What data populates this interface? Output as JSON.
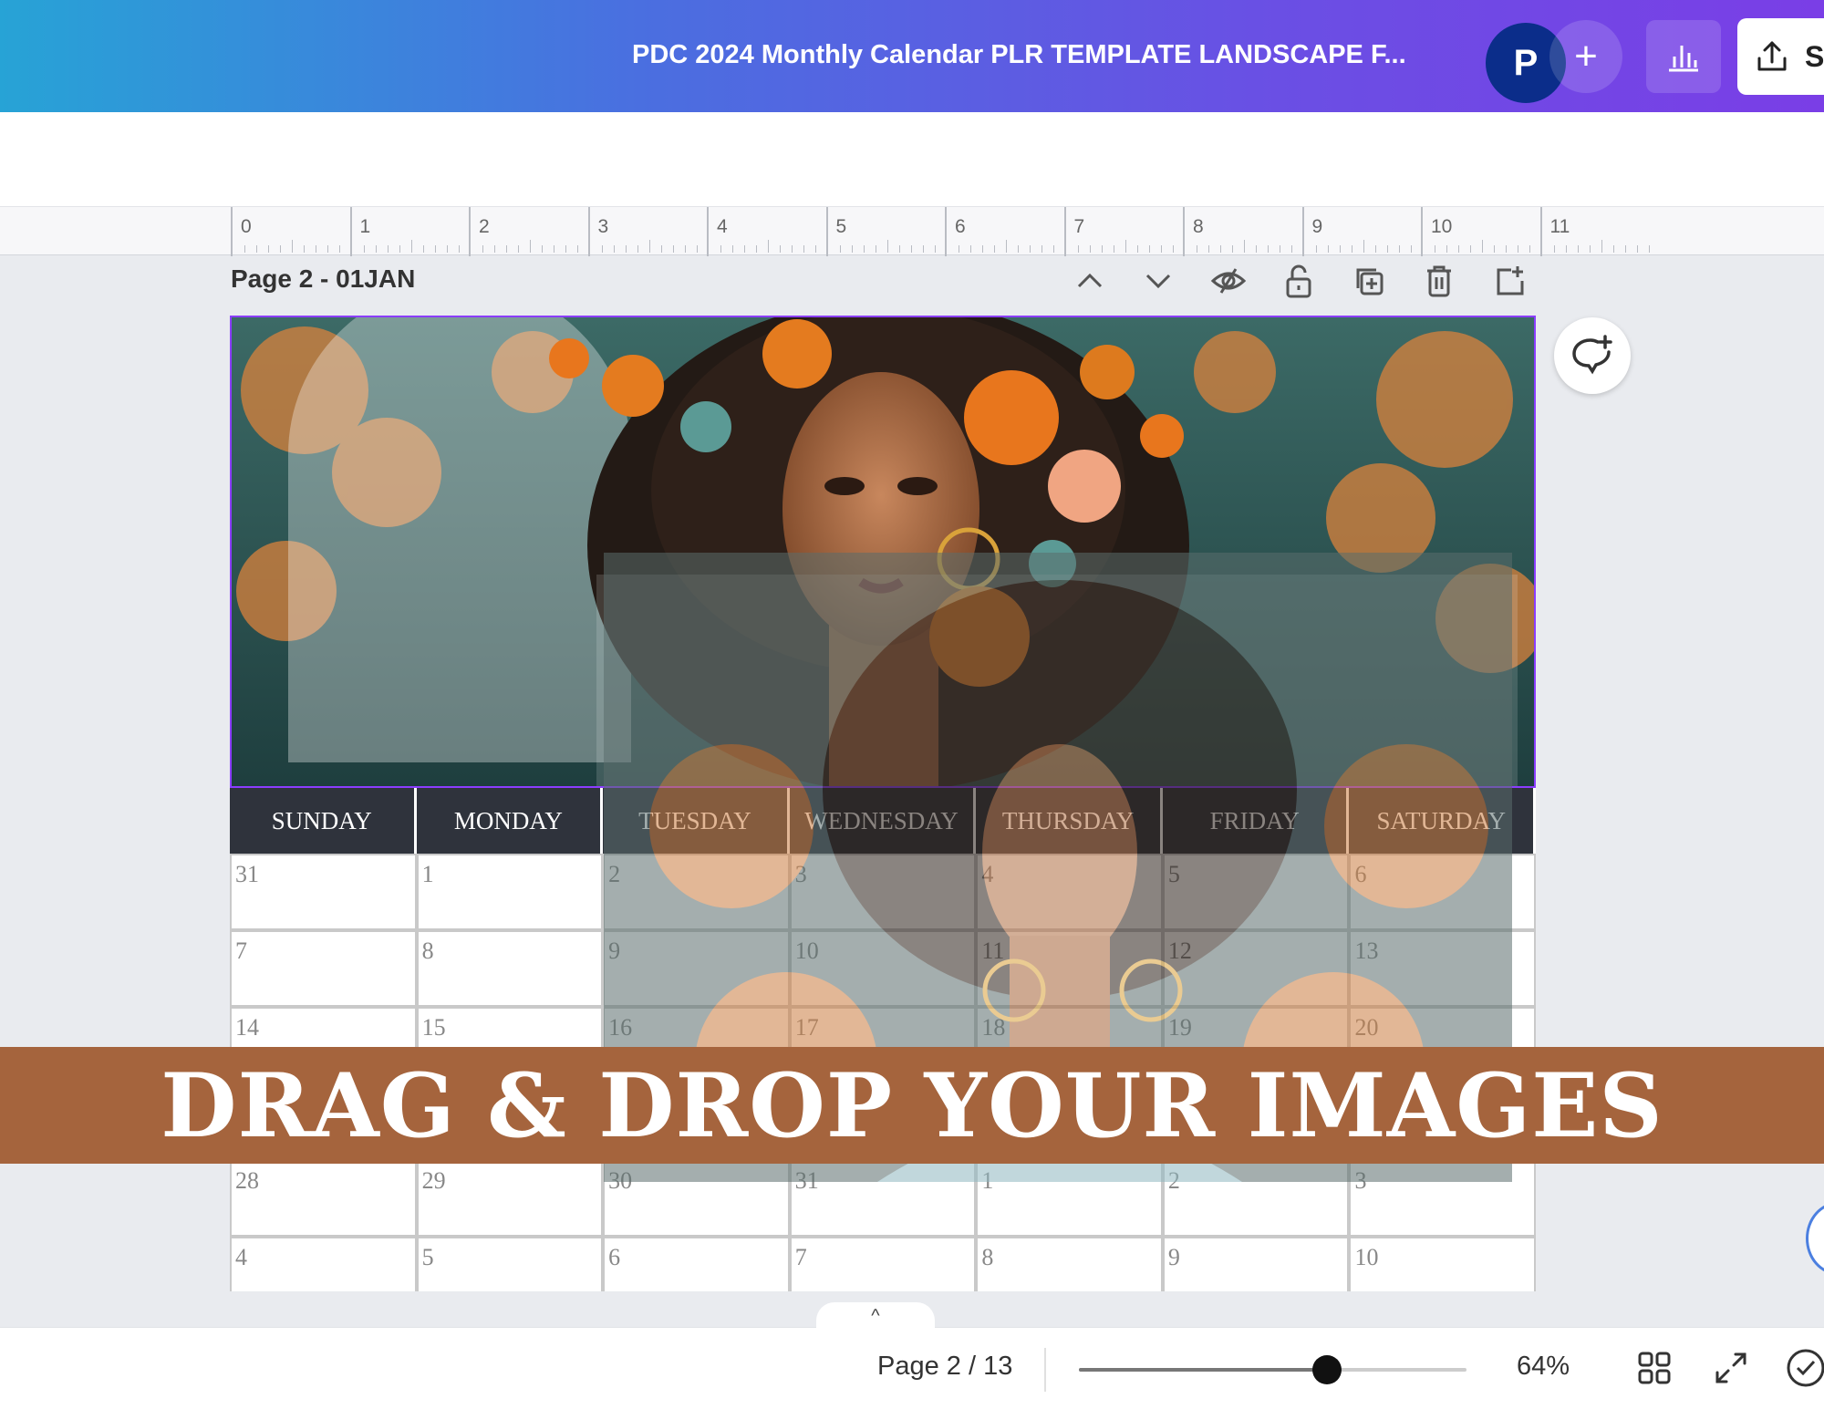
{
  "header": {
    "doc_title": "PDC 2024 Monthly Calendar PLR  TEMPLATE LANDSCAPE F...",
    "avatar_initial": "P",
    "add_label": "+",
    "share_label": "S"
  },
  "ruler": {
    "marks": [
      "0",
      "1",
      "2",
      "3",
      "4",
      "5",
      "6",
      "7",
      "8",
      "9",
      "10",
      "11"
    ]
  },
  "page": {
    "label": "Page 2 - 01JAN"
  },
  "calendar": {
    "weekdays": [
      "SUNDAY",
      "MONDAY",
      "TUESDAY",
      "WEDNESDAY",
      "THURSDAY",
      "FRIDAY",
      "SATURDAY"
    ],
    "rows": [
      [
        "31",
        "1",
        "2",
        "3",
        "4",
        "5",
        "6"
      ],
      [
        "7",
        "8",
        "9",
        "10",
        "11",
        "12",
        "13"
      ],
      [
        "14",
        "15",
        "16",
        "17",
        "18",
        "19",
        "20"
      ],
      [
        "",
        "",
        "",
        "",
        "",
        "",
        ""
      ],
      [
        "28",
        "29",
        "30",
        "31",
        "1",
        "2",
        "3"
      ],
      [
        "4",
        "5",
        "6",
        "7",
        "8",
        "9",
        "10"
      ]
    ]
  },
  "banner": {
    "text": "DRAG & DROP YOUR IMAGES"
  },
  "footer": {
    "collapse_glyph": "^",
    "pager": "Page 2 / 13",
    "zoom": "64%",
    "zoom_level": 0.64
  },
  "colors": {
    "accent_purple": "#8b3dff",
    "banner_brown": "#a5643d",
    "weekday_header": "#2f333c"
  }
}
